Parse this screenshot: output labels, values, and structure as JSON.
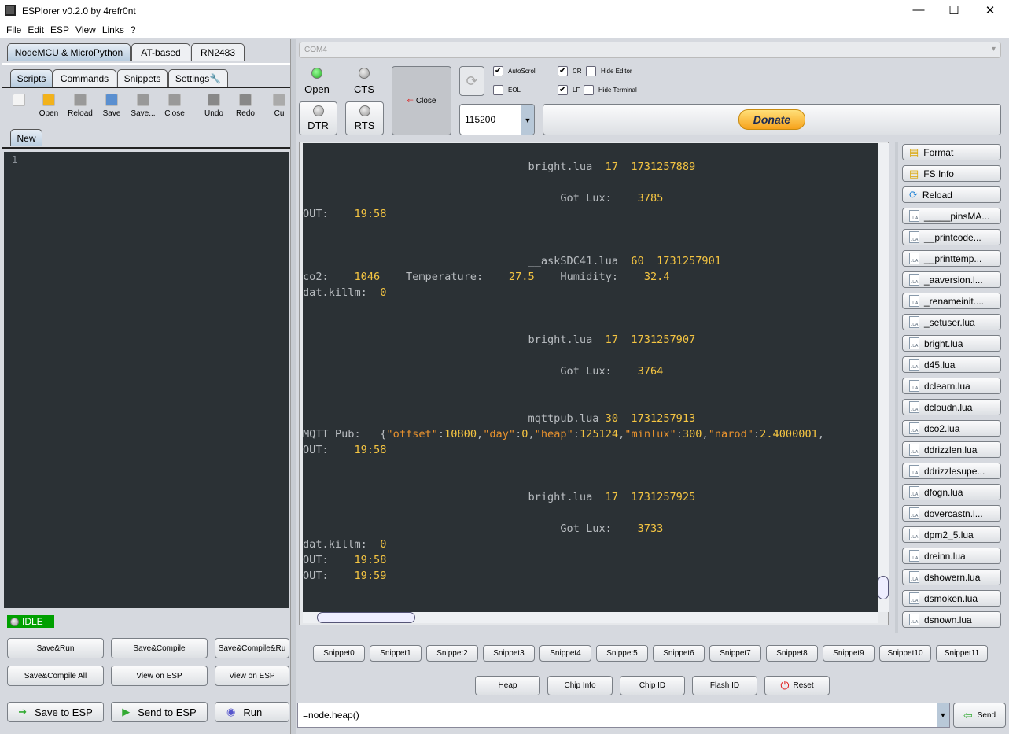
{
  "window": {
    "title": "ESPlorer v0.2.0 by 4refr0nt",
    "minimize": "—",
    "maximize": "☐",
    "close": "✕"
  },
  "menu": [
    "File",
    "Edit",
    "ESP",
    "View",
    "Links",
    "?"
  ],
  "left": {
    "top_tabs": [
      "NodeMCU & MicroPython",
      "AT-based",
      "RN2483"
    ],
    "sub_tabs": [
      "Scripts",
      "Commands",
      "Snippets",
      "Settings"
    ],
    "toolbar": [
      {
        "label": "",
        "icon": "new-file-icon"
      },
      {
        "label": "Open",
        "icon": "folder-open-icon"
      },
      {
        "label": "Reload",
        "icon": "reload-icon"
      },
      {
        "label": "Save",
        "icon": "floppy-icon"
      },
      {
        "label": "Save...",
        "icon": "save-as-icon"
      },
      {
        "label": "Close",
        "icon": "folder-icon"
      },
      {
        "label": "Undo",
        "icon": "undo-icon"
      },
      {
        "label": "Redo",
        "icon": "redo-icon"
      },
      {
        "label": "Cu",
        "icon": "scissors-icon"
      }
    ],
    "file_tab": "New",
    "line_number": "1",
    "status": "IDLE",
    "buttons_row1": [
      "Save&Run",
      "Save&Compile",
      "Save&Compile&Ru"
    ],
    "buttons_row2": [
      "Save&Compile All",
      "View on ESP",
      "View on ESP"
    ],
    "buttons_row3": [
      "Save to ESP",
      "Send to ESP",
      "Run"
    ]
  },
  "right": {
    "port": "COM4",
    "open_label": "Open",
    "cts_label": "CTS",
    "dtr_label": "DTR",
    "rts_label": "RTS",
    "close_label": "Close",
    "baud": "115200",
    "checks": [
      {
        "label": "AutoScroll",
        "checked": true
      },
      {
        "label": "EOL",
        "checked": false
      },
      {
        "label": "CR",
        "checked": true
      },
      {
        "label": "Hide Editor",
        "checked": false
      },
      {
        "label": "LF",
        "checked": true
      },
      {
        "label": "Hide Terminal",
        "checked": false
      }
    ],
    "donate": "Donate",
    "terminal": [
      [],
      [
        {
          "t": "                                   bright.lua  ",
          "c": "w"
        },
        {
          "t": "17  1731257889",
          "c": "y"
        }
      ],
      [],
      [
        {
          "t": "                                        Got Lux:    ",
          "c": "w"
        },
        {
          "t": "3785",
          "c": "y"
        }
      ],
      [
        {
          "t": "OUT:    ",
          "c": "w"
        },
        {
          "t": "19:58",
          "c": "y"
        }
      ],
      [],
      [],
      [
        {
          "t": "                                   __askSDC41.lua  ",
          "c": "w"
        },
        {
          "t": "60  1731257901",
          "c": "y"
        }
      ],
      [
        {
          "t": "co2:    ",
          "c": "w"
        },
        {
          "t": "1046",
          "c": "y"
        },
        {
          "t": "    Temperature:    ",
          "c": "w"
        },
        {
          "t": "27.5",
          "c": "y"
        },
        {
          "t": "    Humidity:    ",
          "c": "w"
        },
        {
          "t": "32.4",
          "c": "y"
        }
      ],
      [
        {
          "t": "dat.killm:  ",
          "c": "w"
        },
        {
          "t": "0",
          "c": "y"
        }
      ],
      [],
      [],
      [
        {
          "t": "                                   bright.lua  ",
          "c": "w"
        },
        {
          "t": "17  1731257907",
          "c": "y"
        }
      ],
      [],
      [
        {
          "t": "                                        Got Lux:    ",
          "c": "w"
        },
        {
          "t": "3764",
          "c": "y"
        }
      ],
      [],
      [],
      [
        {
          "t": "                                   mqttpub.lua ",
          "c": "w"
        },
        {
          "t": "30  1731257913",
          "c": "y"
        }
      ],
      [
        {
          "t": "MQTT Pub:   {",
          "c": "w"
        },
        {
          "t": "\"offset\"",
          "c": "o"
        },
        {
          "t": ":",
          "c": "w"
        },
        {
          "t": "10800",
          "c": "y"
        },
        {
          "t": ",",
          "c": "w"
        },
        {
          "t": "\"day\"",
          "c": "o"
        },
        {
          "t": ":",
          "c": "w"
        },
        {
          "t": "0",
          "c": "y"
        },
        {
          "t": ",",
          "c": "w"
        },
        {
          "t": "\"heap\"",
          "c": "o"
        },
        {
          "t": ":",
          "c": "w"
        },
        {
          "t": "125124",
          "c": "y"
        },
        {
          "t": ",",
          "c": "w"
        },
        {
          "t": "\"minlux\"",
          "c": "o"
        },
        {
          "t": ":",
          "c": "w"
        },
        {
          "t": "300",
          "c": "y"
        },
        {
          "t": ",",
          "c": "w"
        },
        {
          "t": "\"narod\"",
          "c": "o"
        },
        {
          "t": ":",
          "c": "w"
        },
        {
          "t": "2.4000001",
          "c": "y"
        },
        {
          "t": ",",
          "c": "w"
        }
      ],
      [
        {
          "t": "OUT:    ",
          "c": "w"
        },
        {
          "t": "19:58",
          "c": "y"
        }
      ],
      [],
      [],
      [
        {
          "t": "                                   bright.lua  ",
          "c": "w"
        },
        {
          "t": "17  1731257925",
          "c": "y"
        }
      ],
      [],
      [
        {
          "t": "                                        Got Lux:    ",
          "c": "w"
        },
        {
          "t": "3733",
          "c": "y"
        }
      ],
      [
        {
          "t": "dat.killm:  ",
          "c": "w"
        },
        {
          "t": "0",
          "c": "y"
        }
      ],
      [
        {
          "t": "OUT:    ",
          "c": "w"
        },
        {
          "t": "19:58",
          "c": "y"
        }
      ],
      [
        {
          "t": "OUT:    ",
          "c": "w"
        },
        {
          "t": "19:59",
          "c": "y"
        }
      ]
    ],
    "files_top": [
      {
        "label": "Format",
        "icon": "format-icon"
      },
      {
        "label": "FS Info",
        "icon": "fs-info-icon"
      },
      {
        "label": "Reload",
        "icon": "reload-icon"
      }
    ],
    "files": [
      "_____pinsMA...",
      "__printcode...",
      "__printtemp...",
      "_aaversion.l...",
      "_renameinit....",
      "_setuser.lua",
      "bright.lua",
      "d45.lua",
      "dclearn.lua",
      "dcloudn.lua",
      "dco2.lua",
      "ddrizzlen.lua",
      "ddrizzlesupe...",
      "dfogn.lua",
      "dovercastn.l...",
      "dpm2_5.lua",
      "dreinn.lua",
      "dshowern.lua",
      "dsmoken.lua",
      "dsnown.lua"
    ],
    "snippets": [
      "Snippet0",
      "Snippet1",
      "Snippet2",
      "Snippet3",
      "Snippet4",
      "Snippet5",
      "Snippet6",
      "Snippet7",
      "Snippet8",
      "Snippet9",
      "Snippet10",
      "Snippet11"
    ],
    "commands": [
      "Heap",
      "Chip Info",
      "Chip ID",
      "Flash ID",
      "Reset"
    ],
    "command_input": "=node.heap()",
    "send": "Send"
  },
  "colors": {
    "terminal_bg": "#2b3135",
    "text": "#b8bcc0",
    "number": "#f5c542",
    "string": "#e8922e",
    "idle": "#00a000",
    "led_open": "#3cb043"
  }
}
